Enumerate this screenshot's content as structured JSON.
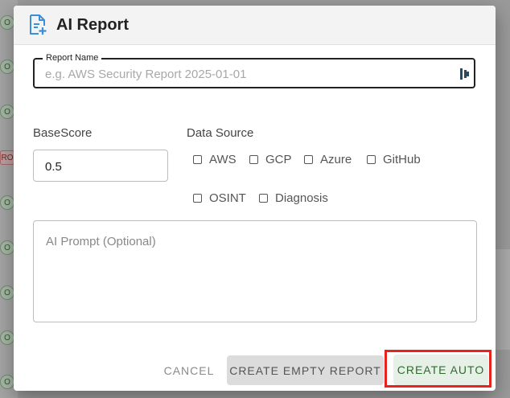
{
  "dialog": {
    "title": "AI Report",
    "header_icon": "document-add-icon"
  },
  "report_name": {
    "label": "Report Name",
    "value": "",
    "placeholder": "e.g. AWS Security Report 2025-01-01",
    "trailing_icon": "password-manager-icon"
  },
  "base_score": {
    "label": "BaseScore",
    "value": "0.5"
  },
  "data_source": {
    "label": "Data Source",
    "options": [
      {
        "label": "AWS",
        "checked": false
      },
      {
        "label": "GCP",
        "checked": false
      },
      {
        "label": "Azure",
        "checked": false
      },
      {
        "label": "GitHub",
        "checked": false
      },
      {
        "label": "OSINT",
        "checked": false
      },
      {
        "label": "Diagnosis",
        "checked": false
      }
    ]
  },
  "ai_prompt": {
    "value": "",
    "placeholder": "AI Prompt (Optional)"
  },
  "actions": {
    "cancel_label": "CANCEL",
    "create_empty_label": "CREATE EMPTY REPORT",
    "create_auto_label": "CREATE AUTO"
  },
  "background": {
    "badges": [
      "O",
      "O",
      "O",
      "RO",
      "O",
      "O",
      "O",
      "O",
      "O",
      "O"
    ]
  },
  "colors": {
    "accent": "#2e6b2e",
    "highlight": "#e8231e",
    "icon_blue": "#3a8fd6"
  }
}
